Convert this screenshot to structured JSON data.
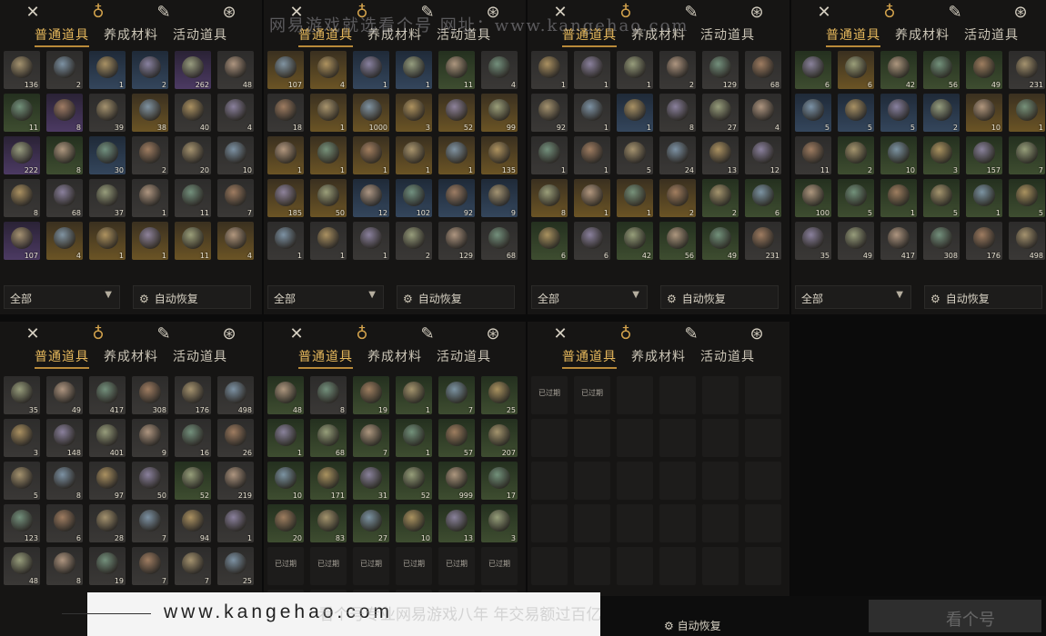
{
  "tabs": [
    "普通道具",
    "养成材料",
    "活动道具"
  ],
  "active_tab": 0,
  "top_icons": [
    "crossed-swords-icon",
    "pouch-icon",
    "scroll-icon",
    "token-icon"
  ],
  "filter_label": "全部",
  "restore_label": "自动恢复",
  "expired_label": "已过期",
  "watermark_top": "网易游戏就选看个号  网址：www.kangehao.com",
  "footer": {
    "url": "www.kangehao.com",
    "slogan": "看个号专业网易游戏八年  年交易额过百亿",
    "restore_label": "自动恢复",
    "corner_logo": "看个号"
  },
  "colors": {
    "accent": "#e6b85c",
    "panel_bg": "#161514"
  },
  "panels": [
    {
      "id": 1,
      "cells": [
        [
          "gray",
          "136"
        ],
        [
          "gray",
          "2"
        ],
        [
          "blue",
          "1"
        ],
        [
          "blue",
          "2"
        ],
        [
          "purple",
          "262"
        ],
        [
          "gray",
          "48"
        ],
        [
          "green",
          "11"
        ],
        [
          "purple",
          "8"
        ],
        [
          "gray",
          "39"
        ],
        [
          "gold",
          "38"
        ],
        [
          "gray",
          "40"
        ],
        [
          "gray",
          "4"
        ],
        [
          "purple",
          "222"
        ],
        [
          "green",
          "8"
        ],
        [
          "blue",
          "30"
        ],
        [
          "gray",
          "2"
        ],
        [
          "gray",
          "20"
        ],
        [
          "gray",
          "10"
        ],
        [
          "gray",
          "8"
        ],
        [
          "gray",
          "68"
        ],
        [
          "gray",
          "37"
        ],
        [
          "gray",
          "1"
        ],
        [
          "gray",
          "11"
        ],
        [
          "gray",
          "7"
        ],
        [
          "purple",
          "107"
        ],
        [
          "gold",
          "4"
        ],
        [
          "gold",
          "1"
        ],
        [
          "gold",
          "1"
        ],
        [
          "gold",
          "11"
        ],
        [
          "gold",
          "4"
        ]
      ]
    },
    {
      "id": 2,
      "cells": [
        [
          "gold",
          "107"
        ],
        [
          "gold",
          "4"
        ],
        [
          "blue",
          "1"
        ],
        [
          "blue",
          "1"
        ],
        [
          "green",
          "11"
        ],
        [
          "gray",
          "4"
        ],
        [
          "gray",
          "18"
        ],
        [
          "gold",
          "1"
        ],
        [
          "gold",
          "1000"
        ],
        [
          "gold",
          "3"
        ],
        [
          "gold",
          "52"
        ],
        [
          "gold",
          "99"
        ],
        [
          "gold",
          "1"
        ],
        [
          "gold",
          "1"
        ],
        [
          "gold",
          "1"
        ],
        [
          "gold",
          "1"
        ],
        [
          "gold",
          "1"
        ],
        [
          "gold",
          "135"
        ],
        [
          "gold",
          "185"
        ],
        [
          "gold",
          "50"
        ],
        [
          "blue",
          "12"
        ],
        [
          "blue",
          "102"
        ],
        [
          "blue",
          "92"
        ],
        [
          "blue",
          "9"
        ],
        [
          "gray",
          "1"
        ],
        [
          "gray",
          "1"
        ],
        [
          "gray",
          "1"
        ],
        [
          "gray",
          "2"
        ],
        [
          "gray",
          "129"
        ],
        [
          "gray",
          "68"
        ]
      ]
    },
    {
      "id": 3,
      "cells": [
        [
          "gray",
          "1"
        ],
        [
          "gray",
          "1"
        ],
        [
          "gray",
          "1"
        ],
        [
          "gray",
          "2"
        ],
        [
          "gray",
          "129"
        ],
        [
          "gray",
          "68"
        ],
        [
          "gray",
          "92"
        ],
        [
          "gray",
          "1"
        ],
        [
          "blue",
          "1"
        ],
        [
          "gray",
          "8"
        ],
        [
          "gray",
          "27"
        ],
        [
          "gray",
          "4"
        ],
        [
          "gray",
          "1"
        ],
        [
          "gray",
          "1"
        ],
        [
          "gray",
          "5"
        ],
        [
          "gray",
          "24"
        ],
        [
          "gray",
          "13"
        ],
        [
          "gray",
          "12"
        ],
        [
          "gold",
          "8"
        ],
        [
          "gold",
          "1"
        ],
        [
          "gold",
          "1"
        ],
        [
          "gold",
          "2"
        ],
        [
          "green",
          "2"
        ],
        [
          "green",
          "6"
        ],
        [
          "green",
          "6"
        ],
        [
          "gray",
          "6"
        ],
        [
          "green",
          "42"
        ],
        [
          "green",
          "56"
        ],
        [
          "green",
          "49"
        ],
        [
          "gray",
          "231"
        ]
      ]
    },
    {
      "id": 4,
      "cells": [
        [
          "green",
          "6"
        ],
        [
          "gold",
          "6"
        ],
        [
          "green",
          "42"
        ],
        [
          "green",
          "56"
        ],
        [
          "green",
          "49"
        ],
        [
          "gray",
          "231"
        ],
        [
          "blue",
          "5"
        ],
        [
          "blue",
          "5"
        ],
        [
          "blue",
          "5"
        ],
        [
          "blue",
          "2"
        ],
        [
          "gold",
          "10"
        ],
        [
          "gold",
          "1"
        ],
        [
          "gray",
          "11"
        ],
        [
          "green",
          "2"
        ],
        [
          "green",
          "10"
        ],
        [
          "green",
          "3"
        ],
        [
          "green",
          "157"
        ],
        [
          "green",
          "7"
        ],
        [
          "green",
          "100"
        ],
        [
          "green",
          "5"
        ],
        [
          "green",
          "1"
        ],
        [
          "green",
          "5"
        ],
        [
          "green",
          "1"
        ],
        [
          "green",
          "5"
        ],
        [
          "gray",
          "35"
        ],
        [
          "gray",
          "49"
        ],
        [
          "gray",
          "417"
        ],
        [
          "gray",
          "308"
        ],
        [
          "gray",
          "176"
        ],
        [
          "gray",
          "498"
        ]
      ]
    },
    {
      "id": 5,
      "cells": [
        [
          "gray",
          "35"
        ],
        [
          "gray",
          "49"
        ],
        [
          "gray",
          "417"
        ],
        [
          "gray",
          "308"
        ],
        [
          "gray",
          "176"
        ],
        [
          "gray",
          "498"
        ],
        [
          "gray",
          "3"
        ],
        [
          "gray",
          "148"
        ],
        [
          "gray",
          "401"
        ],
        [
          "gray",
          "9"
        ],
        [
          "gray",
          "16"
        ],
        [
          "gray",
          "26"
        ],
        [
          "gray",
          "5"
        ],
        [
          "gray",
          "8"
        ],
        [
          "gray",
          "97"
        ],
        [
          "gray",
          "50"
        ],
        [
          "green",
          "52"
        ],
        [
          "gray",
          "219"
        ],
        [
          "gray",
          "123"
        ],
        [
          "gray",
          "6"
        ],
        [
          "gray",
          "28"
        ],
        [
          "gray",
          "7"
        ],
        [
          "gray",
          "94"
        ],
        [
          "gray",
          "1"
        ],
        [
          "gray",
          "48"
        ],
        [
          "gray",
          "8"
        ],
        [
          "gray",
          "19"
        ],
        [
          "gray",
          "7"
        ],
        [
          "gray",
          "7"
        ],
        [
          "gray",
          "25"
        ]
      ]
    },
    {
      "id": 6,
      "cells": [
        [
          "green",
          "48"
        ],
        [
          "gray",
          "8"
        ],
        [
          "green",
          "19"
        ],
        [
          "green",
          "1"
        ],
        [
          "green",
          "7"
        ],
        [
          "green",
          "25"
        ],
        [
          "green",
          "1"
        ],
        [
          "green",
          "68"
        ],
        [
          "green",
          "7"
        ],
        [
          "green",
          "1"
        ],
        [
          "green",
          "57"
        ],
        [
          "green",
          "207"
        ],
        [
          "green",
          "10"
        ],
        [
          "green",
          "171"
        ],
        [
          "green",
          "31"
        ],
        [
          "green",
          "52"
        ],
        [
          "green",
          "999"
        ],
        [
          "green",
          "17"
        ],
        [
          "green",
          "20"
        ],
        [
          "green",
          "83"
        ],
        [
          "green",
          "27"
        ],
        [
          "green",
          "10"
        ],
        [
          "green",
          "13"
        ],
        [
          "green",
          "3"
        ],
        [
          "expired",
          ""
        ],
        [
          "expired",
          ""
        ],
        [
          "expired",
          ""
        ],
        [
          "expired",
          ""
        ],
        [
          "expired",
          ""
        ],
        [
          "expired",
          ""
        ],
        [
          "expired",
          ""
        ],
        [
          "expired",
          ""
        ],
        [
          "empty",
          ""
        ],
        [
          "empty",
          ""
        ],
        [
          "empty",
          ""
        ],
        [
          "empty",
          ""
        ]
      ]
    },
    {
      "id": 7,
      "cells": [
        [
          "expired",
          ""
        ],
        [
          "expired",
          ""
        ],
        [
          "empty",
          ""
        ],
        [
          "empty",
          ""
        ],
        [
          "empty",
          ""
        ],
        [
          "empty",
          ""
        ],
        [
          "empty",
          ""
        ],
        [
          "empty",
          ""
        ],
        [
          "empty",
          ""
        ],
        [
          "empty",
          ""
        ],
        [
          "empty",
          ""
        ],
        [
          "empty",
          ""
        ],
        [
          "empty",
          ""
        ],
        [
          "empty",
          ""
        ],
        [
          "empty",
          ""
        ],
        [
          "empty",
          ""
        ],
        [
          "empty",
          ""
        ],
        [
          "empty",
          ""
        ],
        [
          "empty",
          ""
        ],
        [
          "empty",
          ""
        ],
        [
          "empty",
          ""
        ],
        [
          "empty",
          ""
        ],
        [
          "empty",
          ""
        ],
        [
          "empty",
          ""
        ],
        [
          "empty",
          ""
        ],
        [
          "empty",
          ""
        ],
        [
          "empty",
          ""
        ],
        [
          "empty",
          ""
        ],
        [
          "empty",
          ""
        ],
        [
          "empty",
          ""
        ]
      ]
    }
  ]
}
